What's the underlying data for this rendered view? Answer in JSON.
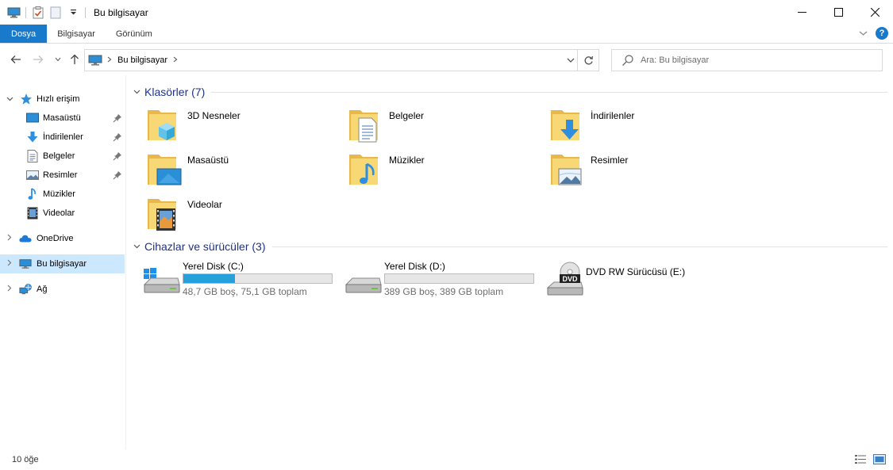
{
  "window": {
    "title": "Bu bilgisayar",
    "controls": {
      "minimize": "minimize",
      "maximize": "maximize",
      "close": "close"
    }
  },
  "ribbon": {
    "tabs": [
      {
        "label": "Dosya",
        "active": true
      },
      {
        "label": "Bilgisayar"
      },
      {
        "label": "Görünüm"
      }
    ],
    "help_label": "?"
  },
  "address": {
    "crumb": "Bu bilgisayar",
    "search_placeholder": "Ara: Bu bilgisayar"
  },
  "sidebar": {
    "quick_access": {
      "label": "Hızlı erişim",
      "items": [
        {
          "label": "Masaüstü",
          "icon": "desktop-icon",
          "pinned": true
        },
        {
          "label": "İndirilenler",
          "icon": "download-icon",
          "pinned": true
        },
        {
          "label": "Belgeler",
          "icon": "documents-icon",
          "pinned": true
        },
        {
          "label": "Resimler",
          "icon": "pictures-icon",
          "pinned": true
        },
        {
          "label": "Müzikler",
          "icon": "music-icon",
          "pinned": false
        },
        {
          "label": "Videolar",
          "icon": "videos-icon",
          "pinned": false
        }
      ]
    },
    "onedrive": {
      "label": "OneDrive"
    },
    "this_pc": {
      "label": "Bu bilgisayar",
      "selected": true
    },
    "network": {
      "label": "Ağ"
    }
  },
  "content": {
    "folders_group": {
      "title": "Klasörler (7)",
      "items": [
        {
          "label": "3D Nesneler",
          "icon": "3d-objects-folder-icon"
        },
        {
          "label": "Belgeler",
          "icon": "documents-folder-icon"
        },
        {
          "label": "İndirilenler",
          "icon": "downloads-folder-icon"
        },
        {
          "label": "Masaüstü",
          "icon": "desktop-folder-icon"
        },
        {
          "label": "Müzikler",
          "icon": "music-folder-icon"
        },
        {
          "label": "Resimler",
          "icon": "pictures-folder-icon"
        },
        {
          "label": "Videolar",
          "icon": "videos-folder-icon"
        }
      ]
    },
    "devices_group": {
      "title": "Cihazlar ve sürücüler (3)",
      "drives": [
        {
          "name": "Yerel Disk (C:)",
          "info": "48,7 GB boş, 75,1 GB toplam",
          "used_fraction": 0.35,
          "icon": "windows-drive-icon"
        },
        {
          "name": "Yerel Disk (D:)",
          "info": "389 GB boş, 389 GB toplam",
          "used_fraction": 0.0,
          "icon": "hard-drive-icon"
        },
        {
          "name": "DVD RW Sürücüsü (E:)",
          "info": "",
          "icon": "dvd-drive-icon",
          "badge": "DVD"
        }
      ]
    }
  },
  "status": {
    "count": "10 öğe"
  },
  "colors": {
    "accent": "#1979ca",
    "selection": "#cce8ff",
    "group_title": "#1e3287",
    "drive_fill": "#26a0da",
    "folder": "#f8d775"
  }
}
